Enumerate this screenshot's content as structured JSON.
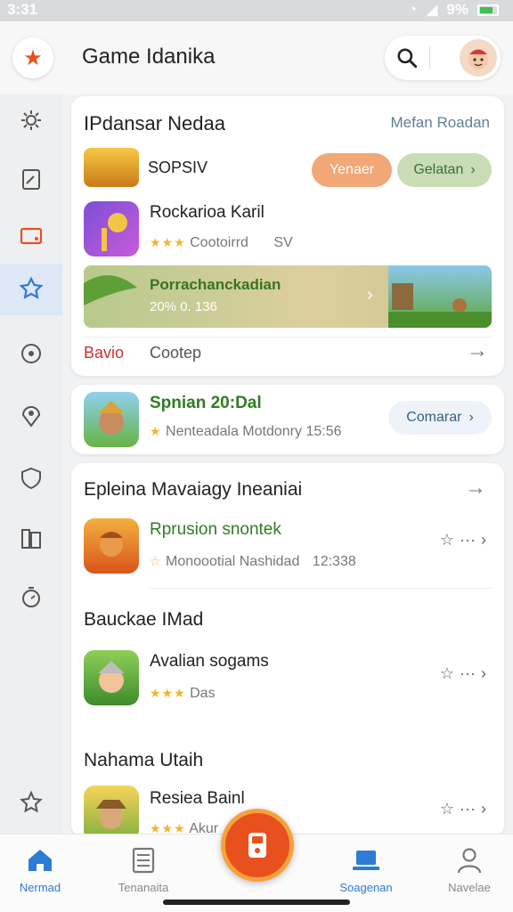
{
  "status": {
    "time": "3:31",
    "battery": "9%"
  },
  "header": {
    "title": "Game Idanika"
  },
  "sidebar": {
    "items": [
      {
        "icon": "gear-icon"
      },
      {
        "icon": "document-icon"
      },
      {
        "icon": "tablet-icon"
      },
      {
        "icon": "star-badge-icon",
        "active": true
      },
      {
        "icon": "target-icon"
      },
      {
        "icon": "location-icon"
      },
      {
        "icon": "shield-icon"
      },
      {
        "icon": "book-icon"
      },
      {
        "icon": "timer-icon"
      },
      {
        "icon": "star-outline-icon"
      }
    ]
  },
  "card1": {
    "title": "IPdansar Nedaa",
    "link": "Mefan Roadan",
    "app1": {
      "name": "SOPSIV",
      "btn1": "Yenaer",
      "btn2": "Gelatan"
    },
    "app2": {
      "name": "Rockarioa Karil",
      "meta": "Cootoirrd",
      "meta2": "SV"
    },
    "banner": {
      "title": "Porrachanckadian",
      "subtitle": "20% 0. 136"
    },
    "footer": {
      "left": "Bavio",
      "right": "Cootep"
    }
  },
  "card2": {
    "name": "Spnian 20:Dal",
    "meta": "Nenteadala Motdonry 15:56",
    "button": "Comarar"
  },
  "card3": {
    "section1": "Epleina Mavaiagy Ineaniai",
    "row1": {
      "name": "Rprusion snontek",
      "meta": "Monoootial Nashidad",
      "time": "12:338"
    },
    "section2": "Bauckae IMad",
    "row2": {
      "name": "Avalian sogams",
      "meta": "Das"
    },
    "section3": "Nahama Utaih",
    "row3": {
      "name": "Resiea Bainl",
      "meta": "Akur"
    }
  },
  "bottom_nav": {
    "items": [
      {
        "label": "Nermad",
        "icon": "home-icon",
        "active": true
      },
      {
        "label": "Tenanaita",
        "icon": "list-icon"
      },
      {
        "label": "Soagenan",
        "icon": "laptop-icon",
        "active": true
      },
      {
        "label": "Navelae",
        "icon": "person-icon"
      }
    ]
  },
  "colors": {
    "accent": "#2d7bd4",
    "orange": "#e8501e",
    "green": "#3b8e2a"
  }
}
